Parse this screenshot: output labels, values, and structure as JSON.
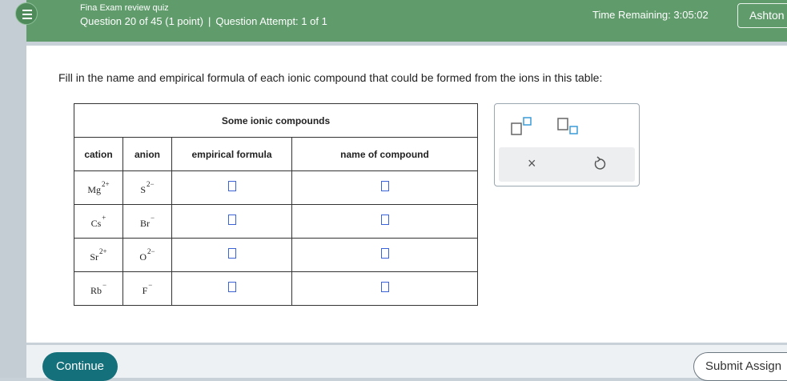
{
  "header": {
    "quiz_title": "Fina Exam review quiz",
    "question_info": "Question 20 of 45 (1 point)",
    "separator": "|",
    "attempt_info": "Question Attempt: 1 of 1",
    "time_remaining": "Time Remaining: 3:05:02",
    "user_name": "Ashton",
    "menu_icon": "hamburger-icon"
  },
  "question": {
    "instruction": "Fill in the name and empirical formula of each ionic compound that could be formed from the ions in this table:"
  },
  "table": {
    "caption": "Some ionic compounds",
    "headers": {
      "cation": "cation",
      "anion": "anion",
      "formula": "empirical formula",
      "name": "name of compound"
    },
    "rows": [
      {
        "cation": {
          "symbol": "Mg",
          "charge": "2+"
        },
        "anion": {
          "symbol": "S",
          "charge": "2−"
        }
      },
      {
        "cation": {
          "symbol": "Cs",
          "charge": "+"
        },
        "anion": {
          "symbol": "Br",
          "charge": "−"
        }
      },
      {
        "cation": {
          "symbol": "Sr",
          "charge": "2+"
        },
        "anion": {
          "symbol": "O",
          "charge": "2−"
        }
      },
      {
        "cation": {
          "symbol": "Rb",
          "charge": "−"
        },
        "anion": {
          "symbol": "F",
          "charge": "−"
        }
      }
    ]
  },
  "palette": {
    "superscript_icon": "superscript-box-icon",
    "subscript_icon": "subscript-box-icon",
    "clear_icon": "close-icon",
    "undo_icon": "undo-icon"
  },
  "footer": {
    "continue_label": "Continue",
    "submit_label": "Submit Assign"
  },
  "colors": {
    "header_bg": "#5f9b6b",
    "continue_bg": "#14707a",
    "input_box": "#3b62d6"
  }
}
